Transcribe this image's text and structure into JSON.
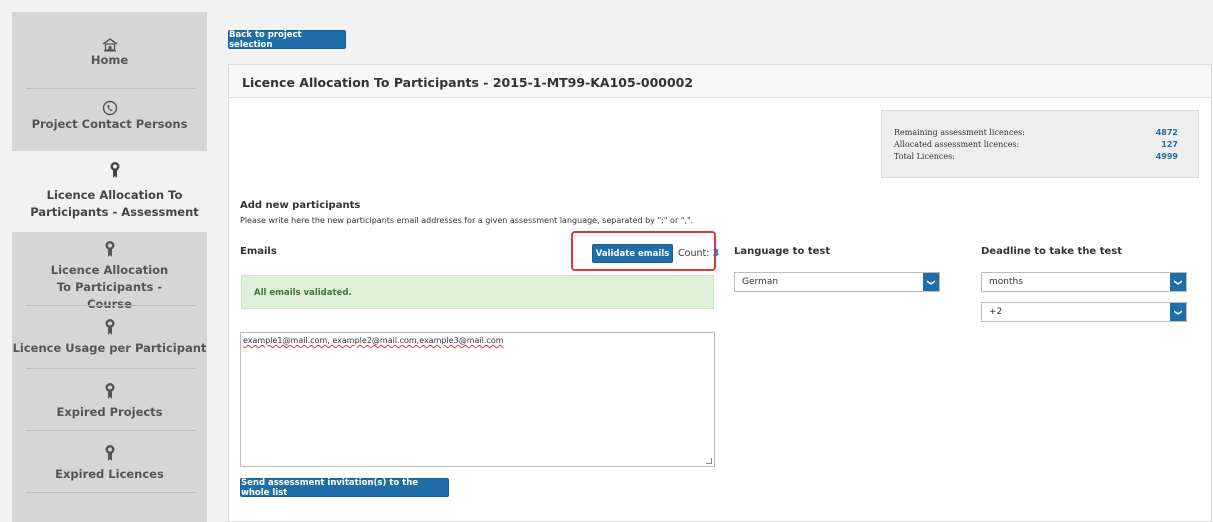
{
  "sidebar": {
    "items": [
      {
        "label": "Home",
        "icon": "home-icon"
      },
      {
        "label": "Project Contact Persons",
        "icon": "contact-icon"
      },
      {
        "label": "Licence Allocation To Participants - Assessment",
        "icon": "licence-icon"
      },
      {
        "label": "Licence Allocation To Participants - Course",
        "icon": "licence-icon"
      },
      {
        "label": "Licence Usage per Participant",
        "icon": "licence-icon"
      },
      {
        "label": "Expired Projects",
        "icon": "licence-icon"
      },
      {
        "label": "Expired Licences",
        "icon": "licence-icon"
      }
    ]
  },
  "back_button": "Back to project selection",
  "panel_title": "Licence Allocation To Participants - 2015-1-MT99-KA105-000002",
  "licences": {
    "remaining_label": "Remaining assessment licences:",
    "remaining_value": "4872",
    "allocated_label": "Allocated assessment licences:",
    "allocated_value": "127",
    "total_label": "Total Licences:",
    "total_value": "4999"
  },
  "add_participants": {
    "title": "Add new participants",
    "hint": "Please write here the new participants email addresses for a given assessment language, separated by \";\" or \",\"."
  },
  "emails": {
    "label": "Emails",
    "validate_button": "Validate emails",
    "count_label": "Count:",
    "count_value": "3",
    "success_message": "All emails validated.",
    "textarea_value": "example1@mail.com, example2@mail.com,example3@mail.com",
    "send_button": "Send assessment invitation(s) to the whole list"
  },
  "language": {
    "label": "Language to test",
    "selected": "German"
  },
  "deadline": {
    "label": "Deadline to take the test",
    "unit_selected": "months",
    "amount_selected": "+2"
  },
  "colors": {
    "primary": "#1f6ea8",
    "highlight": "#e0373c",
    "success_bg": "#dff0d8",
    "success_text": "#3c763d"
  }
}
